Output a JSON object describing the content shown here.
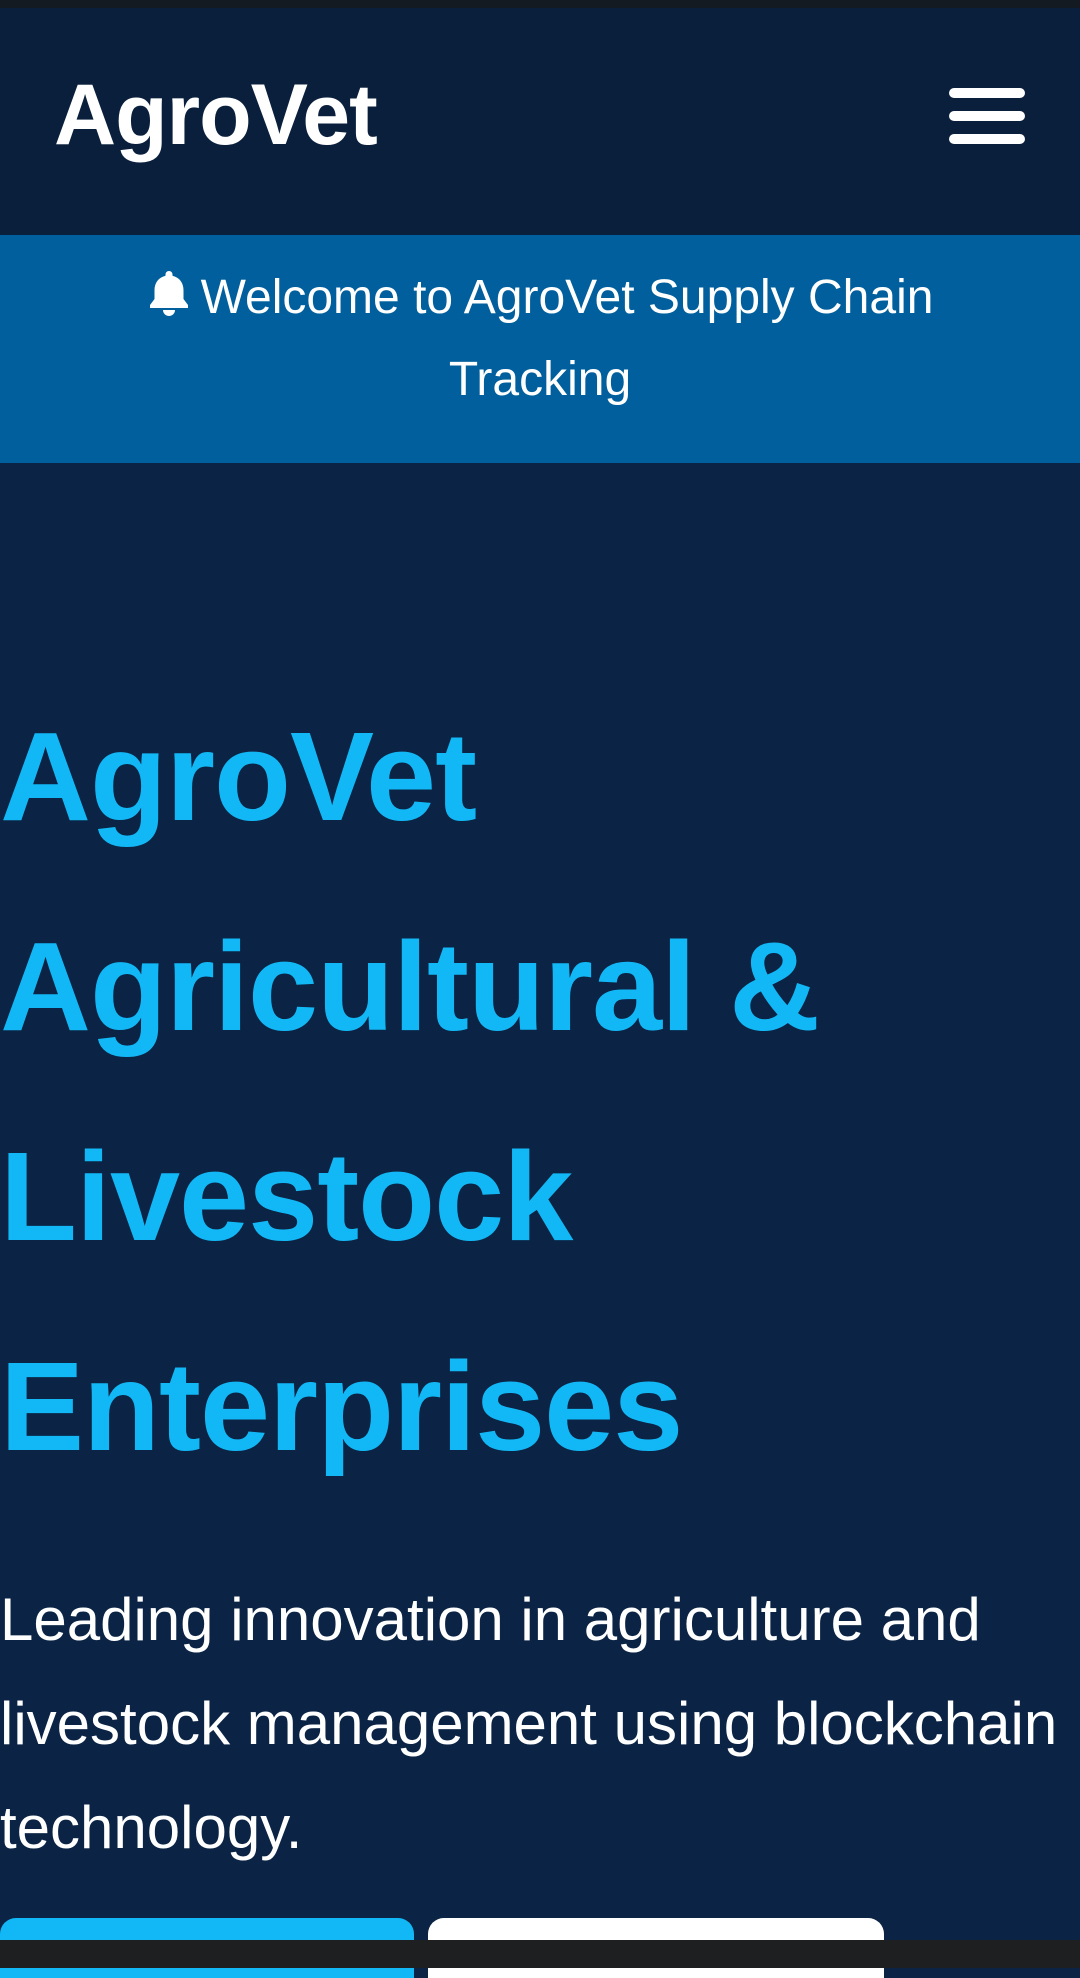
{
  "header": {
    "brand": "AgroVet"
  },
  "banner": {
    "icon": "bell-icon",
    "text": "Welcome to AgroVet Supply Chain Tracking"
  },
  "hero": {
    "title_lines": [
      "AgroVet",
      "Agricultural &",
      "Livestock",
      "Enterprises"
    ],
    "subtitle": "Leading innovation in agriculture and livestock management using blockchain technology."
  },
  "colors": {
    "background": "#0b2344",
    "navbar": "#0a1f3c",
    "banner": "#005f9c",
    "accent": "#12b8f6",
    "text": "#ffffff"
  }
}
